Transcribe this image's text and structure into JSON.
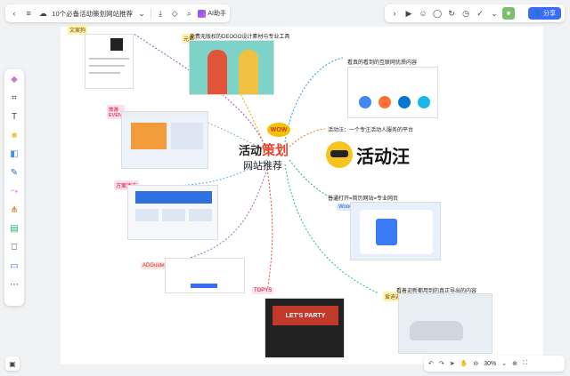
{
  "toolbar_left": {
    "doc_title": "10个必备活动策划网站推荐",
    "ai_label": "AI助手"
  },
  "toolbar_right": {
    "share_label": "分享"
  },
  "zoom": {
    "level": "30%"
  },
  "mindmap": {
    "center_line1_a": "活动",
    "center_line1_b": "策划",
    "center_line2": "网站推荐",
    "wow": "WOW",
    "logo_text": "活动汪",
    "branches": [
      {
        "tag": "文案狗"
      },
      {
        "tag": "元素",
        "label": "免费无版权的DEOGO设计素材与专业工具"
      },
      {
        "tag": "旅游\nEVENT"
      },
      {
        "tag": "方案迷方"
      },
      {
        "tag": "ADGuider"
      },
      {
        "tag": "TOPYS"
      },
      {
        "label": "看真的看到的互联网优质内容"
      },
      {
        "tag": "活动",
        "label": "活动汪：一个专注活动人服务的平台"
      },
      {
        "tag": "Woodo",
        "label": "普通打开=简历网站=专业网页"
      },
      {
        "tag": "爱迪迎",
        "label": "看着迎新都用到的真正导出的内容"
      }
    ],
    "party_text": "LET'S PARTY"
  },
  "colors": {
    "accent_red": "#e8442c",
    "share_blue": "#3b6cf6",
    "logo_yellow": "#f6c41a"
  },
  "icons": {
    "back": "chevron-left-icon",
    "menu": "menu-icon",
    "cloud": "cloud-icon",
    "download": "download-icon",
    "tag": "tag-icon",
    "search": "search-icon"
  }
}
